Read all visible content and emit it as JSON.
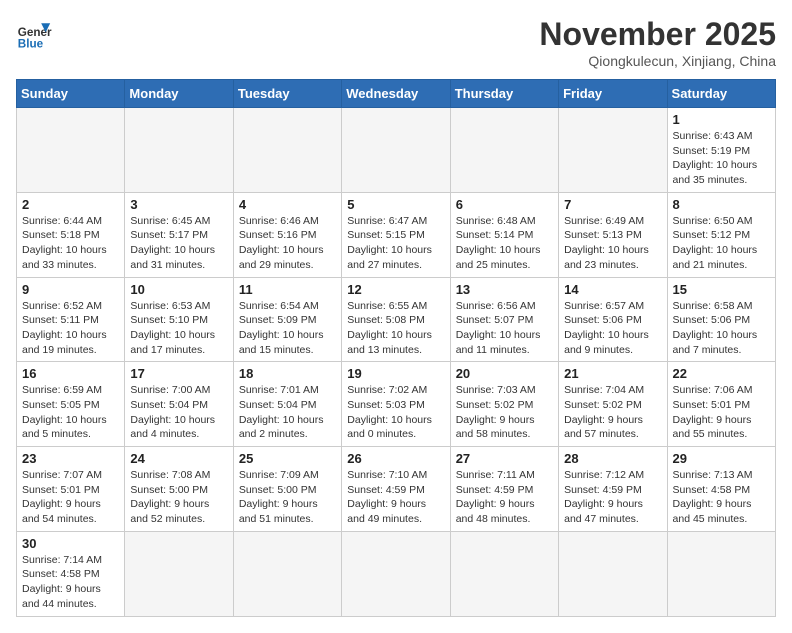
{
  "logo": {
    "line1": "General",
    "line2": "Blue"
  },
  "title": "November 2025",
  "location": "Qiongkulecun, Xinjiang, China",
  "weekdays": [
    "Sunday",
    "Monday",
    "Tuesday",
    "Wednesday",
    "Thursday",
    "Friday",
    "Saturday"
  ],
  "weeks": [
    [
      {
        "day": "",
        "info": ""
      },
      {
        "day": "",
        "info": ""
      },
      {
        "day": "",
        "info": ""
      },
      {
        "day": "",
        "info": ""
      },
      {
        "day": "",
        "info": ""
      },
      {
        "day": "",
        "info": ""
      },
      {
        "day": "1",
        "info": "Sunrise: 6:43 AM\nSunset: 5:19 PM\nDaylight: 10 hours and 35 minutes."
      }
    ],
    [
      {
        "day": "2",
        "info": "Sunrise: 6:44 AM\nSunset: 5:18 PM\nDaylight: 10 hours and 33 minutes."
      },
      {
        "day": "3",
        "info": "Sunrise: 6:45 AM\nSunset: 5:17 PM\nDaylight: 10 hours and 31 minutes."
      },
      {
        "day": "4",
        "info": "Sunrise: 6:46 AM\nSunset: 5:16 PM\nDaylight: 10 hours and 29 minutes."
      },
      {
        "day": "5",
        "info": "Sunrise: 6:47 AM\nSunset: 5:15 PM\nDaylight: 10 hours and 27 minutes."
      },
      {
        "day": "6",
        "info": "Sunrise: 6:48 AM\nSunset: 5:14 PM\nDaylight: 10 hours and 25 minutes."
      },
      {
        "day": "7",
        "info": "Sunrise: 6:49 AM\nSunset: 5:13 PM\nDaylight: 10 hours and 23 minutes."
      },
      {
        "day": "8",
        "info": "Sunrise: 6:50 AM\nSunset: 5:12 PM\nDaylight: 10 hours and 21 minutes."
      }
    ],
    [
      {
        "day": "9",
        "info": "Sunrise: 6:52 AM\nSunset: 5:11 PM\nDaylight: 10 hours and 19 minutes."
      },
      {
        "day": "10",
        "info": "Sunrise: 6:53 AM\nSunset: 5:10 PM\nDaylight: 10 hours and 17 minutes."
      },
      {
        "day": "11",
        "info": "Sunrise: 6:54 AM\nSunset: 5:09 PM\nDaylight: 10 hours and 15 minutes."
      },
      {
        "day": "12",
        "info": "Sunrise: 6:55 AM\nSunset: 5:08 PM\nDaylight: 10 hours and 13 minutes."
      },
      {
        "day": "13",
        "info": "Sunrise: 6:56 AM\nSunset: 5:07 PM\nDaylight: 10 hours and 11 minutes."
      },
      {
        "day": "14",
        "info": "Sunrise: 6:57 AM\nSunset: 5:06 PM\nDaylight: 10 hours and 9 minutes."
      },
      {
        "day": "15",
        "info": "Sunrise: 6:58 AM\nSunset: 5:06 PM\nDaylight: 10 hours and 7 minutes."
      }
    ],
    [
      {
        "day": "16",
        "info": "Sunrise: 6:59 AM\nSunset: 5:05 PM\nDaylight: 10 hours and 5 minutes."
      },
      {
        "day": "17",
        "info": "Sunrise: 7:00 AM\nSunset: 5:04 PM\nDaylight: 10 hours and 4 minutes."
      },
      {
        "day": "18",
        "info": "Sunrise: 7:01 AM\nSunset: 5:04 PM\nDaylight: 10 hours and 2 minutes."
      },
      {
        "day": "19",
        "info": "Sunrise: 7:02 AM\nSunset: 5:03 PM\nDaylight: 10 hours and 0 minutes."
      },
      {
        "day": "20",
        "info": "Sunrise: 7:03 AM\nSunset: 5:02 PM\nDaylight: 9 hours and 58 minutes."
      },
      {
        "day": "21",
        "info": "Sunrise: 7:04 AM\nSunset: 5:02 PM\nDaylight: 9 hours and 57 minutes."
      },
      {
        "day": "22",
        "info": "Sunrise: 7:06 AM\nSunset: 5:01 PM\nDaylight: 9 hours and 55 minutes."
      }
    ],
    [
      {
        "day": "23",
        "info": "Sunrise: 7:07 AM\nSunset: 5:01 PM\nDaylight: 9 hours and 54 minutes."
      },
      {
        "day": "24",
        "info": "Sunrise: 7:08 AM\nSunset: 5:00 PM\nDaylight: 9 hours and 52 minutes."
      },
      {
        "day": "25",
        "info": "Sunrise: 7:09 AM\nSunset: 5:00 PM\nDaylight: 9 hours and 51 minutes."
      },
      {
        "day": "26",
        "info": "Sunrise: 7:10 AM\nSunset: 4:59 PM\nDaylight: 9 hours and 49 minutes."
      },
      {
        "day": "27",
        "info": "Sunrise: 7:11 AM\nSunset: 4:59 PM\nDaylight: 9 hours and 48 minutes."
      },
      {
        "day": "28",
        "info": "Sunrise: 7:12 AM\nSunset: 4:59 PM\nDaylight: 9 hours and 47 minutes."
      },
      {
        "day": "29",
        "info": "Sunrise: 7:13 AM\nSunset: 4:58 PM\nDaylight: 9 hours and 45 minutes."
      }
    ],
    [
      {
        "day": "30",
        "info": "Sunrise: 7:14 AM\nSunset: 4:58 PM\nDaylight: 9 hours and 44 minutes."
      },
      {
        "day": "",
        "info": ""
      },
      {
        "day": "",
        "info": ""
      },
      {
        "day": "",
        "info": ""
      },
      {
        "day": "",
        "info": ""
      },
      {
        "day": "",
        "info": ""
      },
      {
        "day": "",
        "info": ""
      }
    ]
  ]
}
